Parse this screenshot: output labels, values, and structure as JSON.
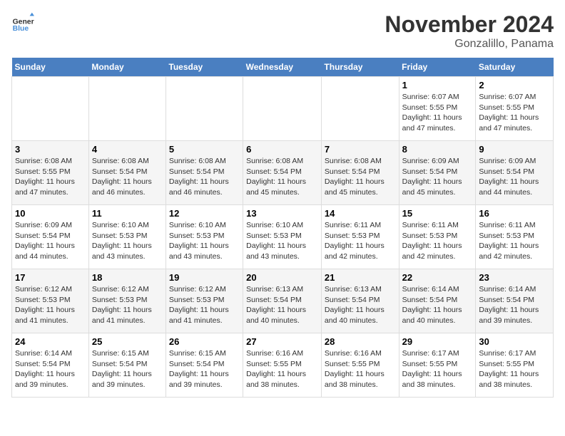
{
  "header": {
    "logo_text1": "General",
    "logo_text2": "Blue",
    "title": "November 2024",
    "subtitle": "Gonzalillo, Panama"
  },
  "days_of_week": [
    "Sunday",
    "Monday",
    "Tuesday",
    "Wednesday",
    "Thursday",
    "Friday",
    "Saturday"
  ],
  "weeks": [
    [
      {
        "day": "",
        "info": ""
      },
      {
        "day": "",
        "info": ""
      },
      {
        "day": "",
        "info": ""
      },
      {
        "day": "",
        "info": ""
      },
      {
        "day": "",
        "info": ""
      },
      {
        "day": "1",
        "info": "Sunrise: 6:07 AM\nSunset: 5:55 PM\nDaylight: 11 hours and 47 minutes."
      },
      {
        "day": "2",
        "info": "Sunrise: 6:07 AM\nSunset: 5:55 PM\nDaylight: 11 hours and 47 minutes."
      }
    ],
    [
      {
        "day": "3",
        "info": "Sunrise: 6:08 AM\nSunset: 5:55 PM\nDaylight: 11 hours and 47 minutes."
      },
      {
        "day": "4",
        "info": "Sunrise: 6:08 AM\nSunset: 5:54 PM\nDaylight: 11 hours and 46 minutes."
      },
      {
        "day": "5",
        "info": "Sunrise: 6:08 AM\nSunset: 5:54 PM\nDaylight: 11 hours and 46 minutes."
      },
      {
        "day": "6",
        "info": "Sunrise: 6:08 AM\nSunset: 5:54 PM\nDaylight: 11 hours and 45 minutes."
      },
      {
        "day": "7",
        "info": "Sunrise: 6:08 AM\nSunset: 5:54 PM\nDaylight: 11 hours and 45 minutes."
      },
      {
        "day": "8",
        "info": "Sunrise: 6:09 AM\nSunset: 5:54 PM\nDaylight: 11 hours and 45 minutes."
      },
      {
        "day": "9",
        "info": "Sunrise: 6:09 AM\nSunset: 5:54 PM\nDaylight: 11 hours and 44 minutes."
      }
    ],
    [
      {
        "day": "10",
        "info": "Sunrise: 6:09 AM\nSunset: 5:54 PM\nDaylight: 11 hours and 44 minutes."
      },
      {
        "day": "11",
        "info": "Sunrise: 6:10 AM\nSunset: 5:53 PM\nDaylight: 11 hours and 43 minutes."
      },
      {
        "day": "12",
        "info": "Sunrise: 6:10 AM\nSunset: 5:53 PM\nDaylight: 11 hours and 43 minutes."
      },
      {
        "day": "13",
        "info": "Sunrise: 6:10 AM\nSunset: 5:53 PM\nDaylight: 11 hours and 43 minutes."
      },
      {
        "day": "14",
        "info": "Sunrise: 6:11 AM\nSunset: 5:53 PM\nDaylight: 11 hours and 42 minutes."
      },
      {
        "day": "15",
        "info": "Sunrise: 6:11 AM\nSunset: 5:53 PM\nDaylight: 11 hours and 42 minutes."
      },
      {
        "day": "16",
        "info": "Sunrise: 6:11 AM\nSunset: 5:53 PM\nDaylight: 11 hours and 42 minutes."
      }
    ],
    [
      {
        "day": "17",
        "info": "Sunrise: 6:12 AM\nSunset: 5:53 PM\nDaylight: 11 hours and 41 minutes."
      },
      {
        "day": "18",
        "info": "Sunrise: 6:12 AM\nSunset: 5:53 PM\nDaylight: 11 hours and 41 minutes."
      },
      {
        "day": "19",
        "info": "Sunrise: 6:12 AM\nSunset: 5:53 PM\nDaylight: 11 hours and 41 minutes."
      },
      {
        "day": "20",
        "info": "Sunrise: 6:13 AM\nSunset: 5:54 PM\nDaylight: 11 hours and 40 minutes."
      },
      {
        "day": "21",
        "info": "Sunrise: 6:13 AM\nSunset: 5:54 PM\nDaylight: 11 hours and 40 minutes."
      },
      {
        "day": "22",
        "info": "Sunrise: 6:14 AM\nSunset: 5:54 PM\nDaylight: 11 hours and 40 minutes."
      },
      {
        "day": "23",
        "info": "Sunrise: 6:14 AM\nSunset: 5:54 PM\nDaylight: 11 hours and 39 minutes."
      }
    ],
    [
      {
        "day": "24",
        "info": "Sunrise: 6:14 AM\nSunset: 5:54 PM\nDaylight: 11 hours and 39 minutes."
      },
      {
        "day": "25",
        "info": "Sunrise: 6:15 AM\nSunset: 5:54 PM\nDaylight: 11 hours and 39 minutes."
      },
      {
        "day": "26",
        "info": "Sunrise: 6:15 AM\nSunset: 5:54 PM\nDaylight: 11 hours and 39 minutes."
      },
      {
        "day": "27",
        "info": "Sunrise: 6:16 AM\nSunset: 5:55 PM\nDaylight: 11 hours and 38 minutes."
      },
      {
        "day": "28",
        "info": "Sunrise: 6:16 AM\nSunset: 5:55 PM\nDaylight: 11 hours and 38 minutes."
      },
      {
        "day": "29",
        "info": "Sunrise: 6:17 AM\nSunset: 5:55 PM\nDaylight: 11 hours and 38 minutes."
      },
      {
        "day": "30",
        "info": "Sunrise: 6:17 AM\nSunset: 5:55 PM\nDaylight: 11 hours and 38 minutes."
      }
    ]
  ]
}
